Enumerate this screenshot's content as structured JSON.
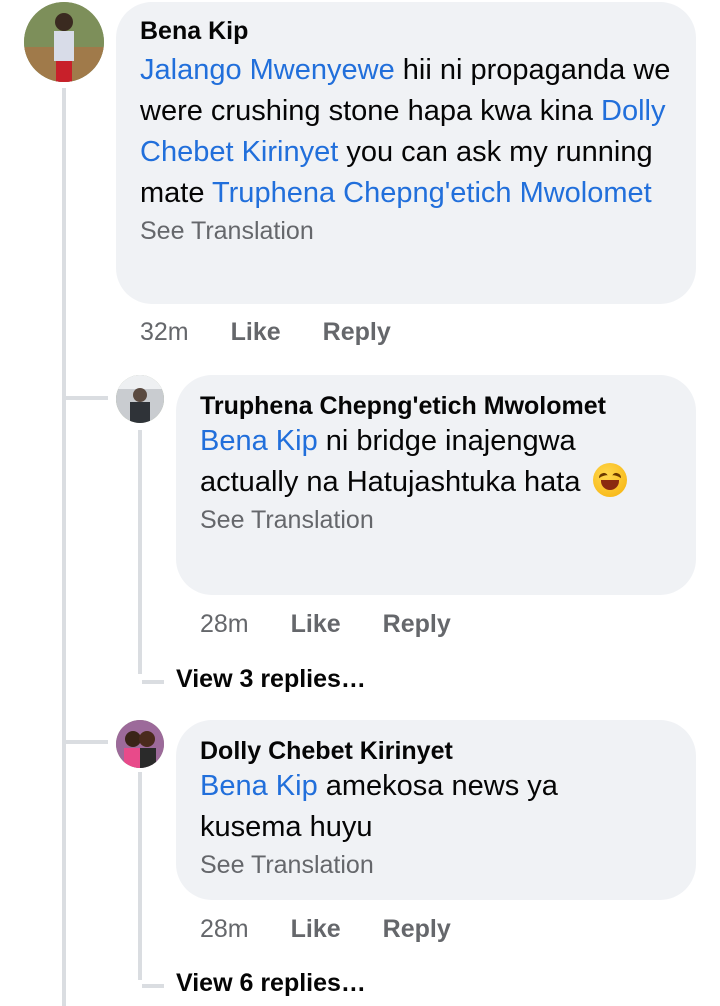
{
  "comments": [
    {
      "author": "Bena Kip",
      "segments": [
        {
          "text": "Jalango Mwenyewe",
          "mention": true
        },
        {
          "text": " hii ni propaganda we were crushing stone hapa kwa kina ",
          "mention": false
        },
        {
          "text": "Dolly Chebet Kirinyet",
          "mention": true
        },
        {
          "text": " you can ask my running mate ",
          "mention": false
        },
        {
          "text": "Truphena Chepng'etich Mwolomet",
          "mention": true
        }
      ],
      "see_translation": "See Translation",
      "time": "32m",
      "like": "Like",
      "reply": "Reply"
    },
    {
      "author": "Truphena Chepng'etich Mwolomet",
      "segments": [
        {
          "text": "Bena Kip",
          "mention": true
        },
        {
          "text": " ni bridge inajengwa actually na Hatujashtuka hata",
          "mention": false
        }
      ],
      "emoji": "rolling-on-floor-laughing-emoji",
      "see_translation": "See Translation",
      "time": "28m",
      "like": "Like",
      "reply": "Reply",
      "view_replies": "View 3 replies…"
    },
    {
      "author": "Dolly Chebet Kirinyet",
      "segments": [
        {
          "text": "Bena Kip",
          "mention": true
        },
        {
          "text": " amekosa news ya kusema huyu",
          "mention": false
        }
      ],
      "see_translation": "See Translation",
      "time": "28m",
      "like": "Like",
      "reply": "Reply",
      "view_replies": "View 6 replies…"
    }
  ],
  "colors": {
    "bubble": "#f0f2f5",
    "mention": "#216fdb",
    "meta": "#65676b",
    "thread_line": "#dadde1"
  }
}
